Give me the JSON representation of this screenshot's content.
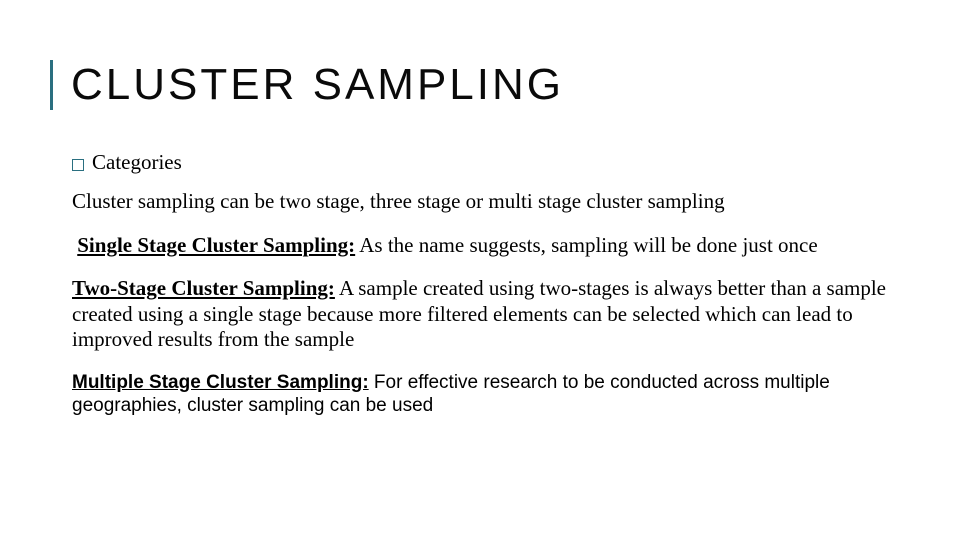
{
  "title": "CLUSTER SAMPLING",
  "bullet": "Categories",
  "intro": "Cluster sampling can be two stage, three stage or multi stage cluster sampling",
  "items": [
    {
      "lead": "Single Stage Cluster Sampling:",
      "text": " As the name suggests, sampling will be done just once"
    },
    {
      "lead": "Two-Stage Cluster Sampling:",
      "text": " A sample created using two-stages is always better than a sample created using a single stage because more filtered elements can be selected which can lead to improved results from the sample"
    },
    {
      "lead": "Multiple Stage Cluster Sampling:",
      "text": " For effective research to be conducted across multiple geographies, cluster sampling can be used"
    }
  ]
}
